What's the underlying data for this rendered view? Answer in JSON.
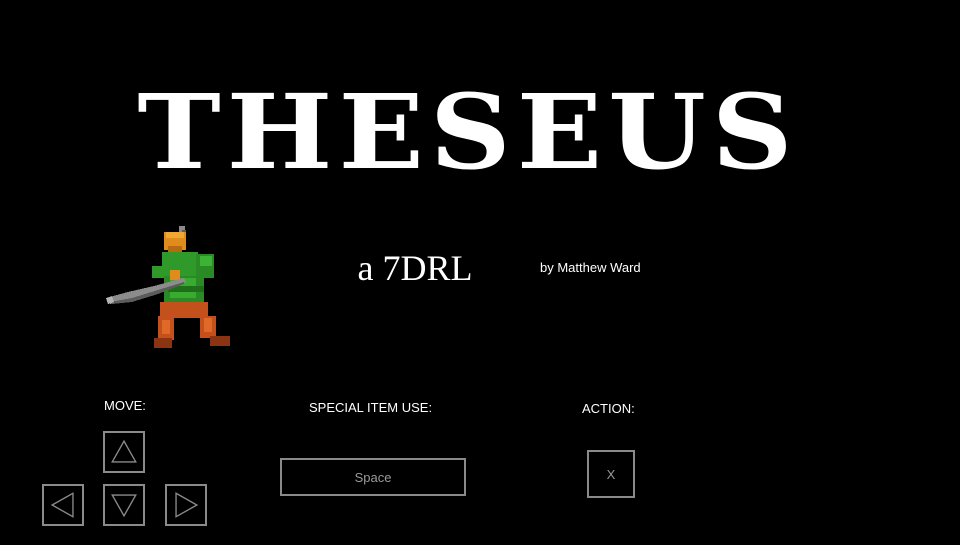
{
  "title": "THESEUS",
  "subtitle": "a 7DRL",
  "byline": "by Matthew Ward",
  "controls": {
    "move": {
      "label": "MOVE:",
      "keys": [
        "up-arrow-icon",
        "left-arrow-icon",
        "down-arrow-icon",
        "right-arrow-icon"
      ]
    },
    "special": {
      "label": "SPECIAL ITEM USE:",
      "key": "Space"
    },
    "action": {
      "label": "ACTION:",
      "key": "X"
    }
  },
  "colors": {
    "background": "#000000",
    "text": "#ffffff",
    "key_border": "#8a8a8a",
    "key_text": "#9a9a9a",
    "hero_tunic": "#2f9a2a",
    "hero_skin": "#e08c1c",
    "hero_pants": "#c4501c",
    "hero_sword": "#8c8c8c"
  }
}
